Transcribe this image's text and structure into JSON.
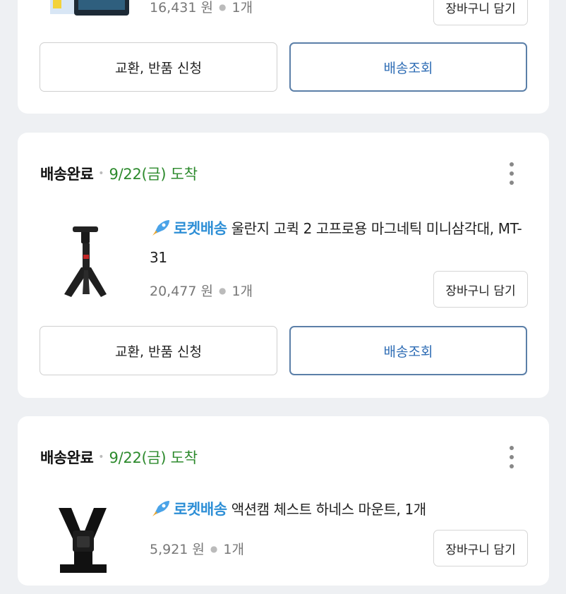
{
  "orders": [
    {
      "product": {
        "rocket_label": "",
        "name": "",
        "price": "16,431 원",
        "qty": "1개"
      },
      "cart_label": "장바구니 담기",
      "return_label": "교환, 반품 신청",
      "track_label": "배송조회"
    },
    {
      "status": "배송완료",
      "arrival": "9/22(금) 도착",
      "product": {
        "rocket_label": "로켓배송",
        "name": "울란지 고퀵 2 고프로용 마그네틱 미니삼각대, MT-31",
        "price": "20,477 원",
        "qty": "1개"
      },
      "cart_label": "장바구니 담기",
      "return_label": "교환, 반품 신청",
      "track_label": "배송조회"
    },
    {
      "status": "배송완료",
      "arrival": "9/22(금) 도착",
      "product": {
        "rocket_label": "로켓배송",
        "name": "액션캠 체스트 하네스 마운트, 1개",
        "price": "5,921 원",
        "qty": "1개"
      },
      "cart_label": "장바구니 담기"
    }
  ],
  "colors": {
    "arrival": "#2d8a2d",
    "rocket": "#2e8fd6",
    "track_border": "#5b7fa8"
  },
  "icons": {
    "rocket": "rocket-icon",
    "more": "kebab-menu-icon"
  }
}
